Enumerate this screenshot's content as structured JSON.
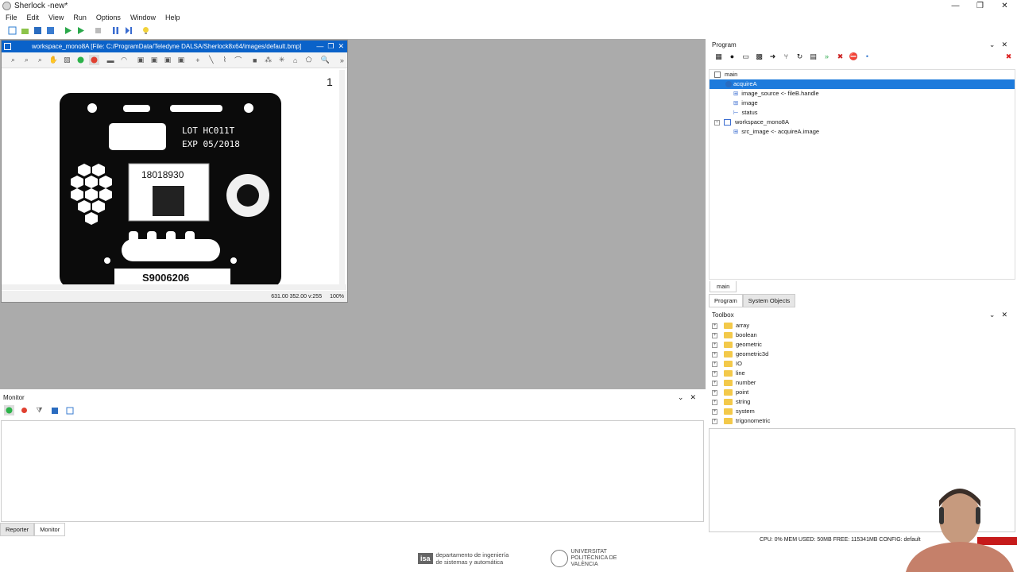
{
  "window": {
    "title": "Sherlock -new*",
    "min": "—",
    "max": "❐",
    "close": "✕"
  },
  "menu": [
    "File",
    "Edit",
    "View",
    "Run",
    "Options",
    "Window",
    "Help"
  ],
  "image_window": {
    "title": "workspace_mono8A [File: C:/ProgramData/Teledyne DALSA/Sherlock8x64/images/default.bmp]",
    "page_num": "1",
    "status_coords": "631.00 352.00  v:255",
    "zoom": "100%"
  },
  "image_content": {
    "lot": "LOT HC011T",
    "exp": "EXP 05/2018",
    "code": "18018930",
    "serial": "S9006206"
  },
  "program": {
    "title": "Program",
    "tree": [
      {
        "label": "main",
        "indent": 0,
        "selected": false
      },
      {
        "label": "acquireA",
        "indent": 1,
        "selected": true
      },
      {
        "label": "image_source <- fileB.handle",
        "indent": 2,
        "selected": false
      },
      {
        "label": "image",
        "indent": 2,
        "selected": false
      },
      {
        "label": "status",
        "indent": 2,
        "selected": false
      },
      {
        "label": "workspace_mono8A",
        "indent": 1,
        "selected": false
      },
      {
        "label": "src_image <- acquireA.image",
        "indent": 2,
        "selected": false
      }
    ],
    "bottom_tab": "main",
    "tabs": [
      "Program",
      "System Objects"
    ]
  },
  "toolbox": {
    "title": "Toolbox",
    "items": [
      "array",
      "boolean",
      "geometric",
      "geometric3d",
      "IO",
      "line",
      "number",
      "point",
      "string",
      "system",
      "trigonometric"
    ]
  },
  "monitor": {
    "title": "Monitor",
    "tabs": [
      "Reporter",
      "Monitor"
    ]
  },
  "status": "CPU: 0% MEM USED: 50MB FREE: 115341MB  CONFIG: default",
  "footer": {
    "isa_mark": "isa",
    "isa_text": "departamento de ingeniería de sistemas y automática",
    "upv_text": "UNIVERSITAT POLITÈCNICA DE VALÈNCIA"
  }
}
